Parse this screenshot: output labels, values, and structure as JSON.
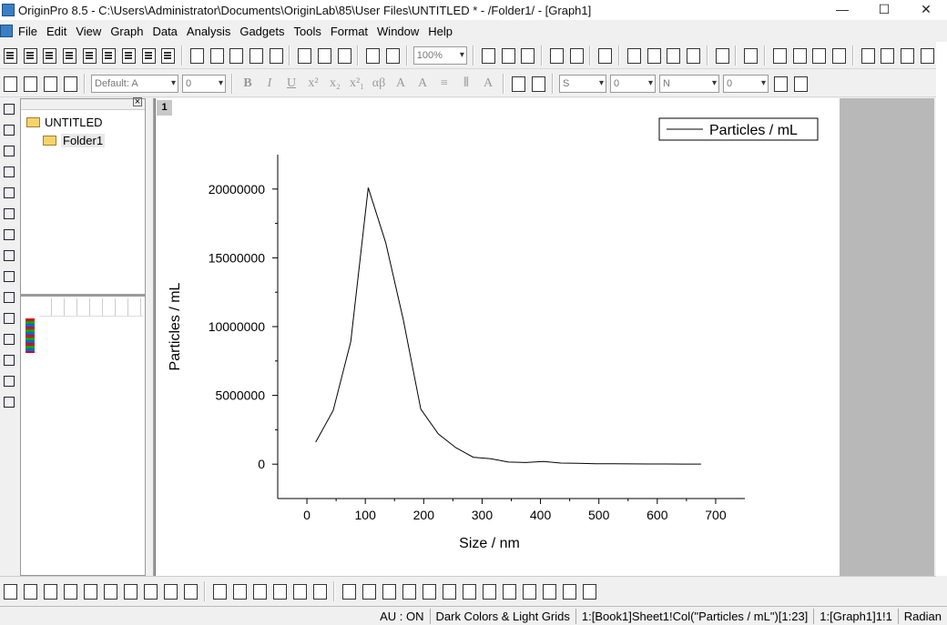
{
  "window": {
    "title": "OriginPro 8.5 - C:\\Users\\Administrator\\Documents\\OriginLab\\85\\User Files\\UNTITLED * - /Folder1/ - [Graph1]",
    "controls": [
      "—",
      "☐",
      "✕"
    ]
  },
  "menu": {
    "items": [
      "File",
      "Edit",
      "View",
      "Graph",
      "Data",
      "Analysis",
      "Gadgets",
      "Tools",
      "Format",
      "Window",
      "Help"
    ]
  },
  "toolbar": {
    "zoom": "100%",
    "font": "Default: A",
    "font_size": "0",
    "line_style": "S",
    "line_width": "0",
    "fill_pattern": "N",
    "fill_width": "0"
  },
  "explorer": {
    "root": "UNTITLED",
    "folder": "Folder1"
  },
  "graph": {
    "layer_label": "1"
  },
  "chart_data": {
    "type": "line",
    "xlabel": "Size / nm",
    "ylabel": "Particles / mL",
    "legend": [
      "Particles / mL"
    ],
    "legend_position": "top-right",
    "xlim": [
      -50,
      750
    ],
    "ylim": [
      -2500000,
      22500000
    ],
    "xticks": [
      0,
      100,
      200,
      300,
      400,
      500,
      600,
      700
    ],
    "yticks": [
      0,
      5000000,
      10000000,
      15000000,
      20000000
    ],
    "grid": false,
    "series": [
      {
        "name": "Particles / mL",
        "x": [
          15,
          45,
          75,
          105,
          135,
          165,
          195,
          225,
          255,
          285,
          315,
          345,
          375,
          405,
          435,
          465,
          495,
          525,
          555,
          585,
          615,
          645,
          675
        ],
        "y": [
          1600000,
          3900000,
          8900000,
          20100000,
          16100000,
          10500000,
          4000000,
          2200000,
          1200000,
          500000,
          400000,
          150000,
          120000,
          200000,
          80000,
          60000,
          30000,
          25000,
          20000,
          15000,
          10000,
          8000,
          5000
        ]
      }
    ]
  },
  "status": {
    "au": "AU : ON",
    "theme": "Dark Colors & Light Grids",
    "column": "1:[Book1]Sheet1!Col(\"Particles / mL\")[1:23]",
    "graph": "1:[Graph1]1!1",
    "angle": "Radian"
  }
}
